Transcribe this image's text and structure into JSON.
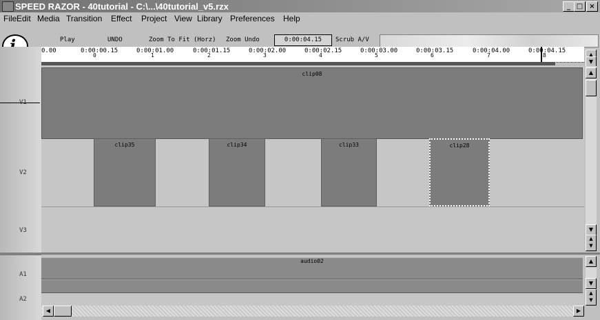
{
  "window": {
    "title": "SPEED RAZOR - 40tutorial - C:\\...\\40tutorial_v5.rzx",
    "minimize": "_",
    "maximize": "□",
    "close": "×"
  },
  "menu": [
    "File",
    "Edit",
    "Media",
    "Transition",
    "Effect",
    "Project",
    "View",
    "Library",
    "Preferences",
    "Help"
  ],
  "toolbar": {
    "play": "Play",
    "undo": "UNDO",
    "zoom_fit": "Zoom To Fit (Horz)",
    "zoom_undo": "Zoom Undo",
    "timecode": "0:00:04.15",
    "scrub": "Scrub A/V"
  },
  "logo": "i",
  "ruler": {
    "labels": [
      "0.00",
      "0:00:00.15",
      "0:00:01.00",
      "0:00:01.15",
      "0:00:02.00",
      "0:00:02.15",
      "0:00:03.00",
      "0:00:03.15",
      "0:00:04.00",
      "0:00:04.15"
    ],
    "numbers": [
      "0",
      "1",
      "2",
      "3",
      "4",
      "5",
      "6",
      "7",
      "8"
    ]
  },
  "tracks": {
    "v1": "V1",
    "v2": "V2",
    "v3": "V3",
    "a1": "A1",
    "a2": "A2"
  },
  "clips": {
    "v1": "clip08",
    "v2": [
      "clip35",
      "clip34",
      "clip33",
      "clip28"
    ],
    "a1": "audio02"
  }
}
